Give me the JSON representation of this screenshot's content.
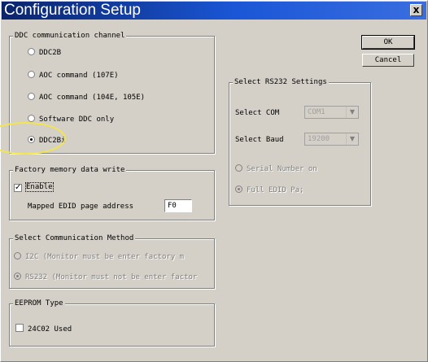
{
  "window": {
    "title": "Configuration Setup",
    "close_glyph": "x"
  },
  "ddc_group": {
    "legend": "DDC communication channel",
    "options": [
      {
        "label": "DDC2B",
        "selected": false
      },
      {
        "label": "AOC command (107E)",
        "selected": false
      },
      {
        "label": "AOC command (104E, 105E)",
        "selected": false
      },
      {
        "label": "Software DDC only",
        "selected": false
      },
      {
        "label": "DDC2Bi",
        "selected": true
      }
    ]
  },
  "factory_group": {
    "legend": "Factory memory data write",
    "enable_label": "Enable",
    "enable_checked": true,
    "address_label": "Mapped EDID page address",
    "address_value": "F0"
  },
  "comm_group": {
    "legend": "Select Communication Method",
    "options": [
      {
        "label": "I2C  (Monitor must be enter factory m",
        "selected": false
      },
      {
        "label": "RS232 (Monitor must not be enter factor",
        "selected": true
      }
    ]
  },
  "eeprom_group": {
    "legend": "EEPROM Type",
    "checkbox_label": "24C02 Used",
    "checked": false
  },
  "rs232_group": {
    "legend": "Select RS232 Settings",
    "com_label": "Select COM",
    "com_value": "COM1",
    "baud_label": "Select Baud",
    "baud_value": "19200",
    "options": [
      {
        "label": "Serial Number on",
        "selected": false
      },
      {
        "label": "Full EDID Pa;",
        "selected": true
      }
    ]
  },
  "buttons": {
    "ok": "OK",
    "cancel": "Cancel"
  },
  "colors": {
    "titlebar_start": "#0a246a",
    "titlebar_end": "#3a6ee0",
    "face": "#d4d0c8",
    "highlight_marker": "#f3e64a"
  }
}
